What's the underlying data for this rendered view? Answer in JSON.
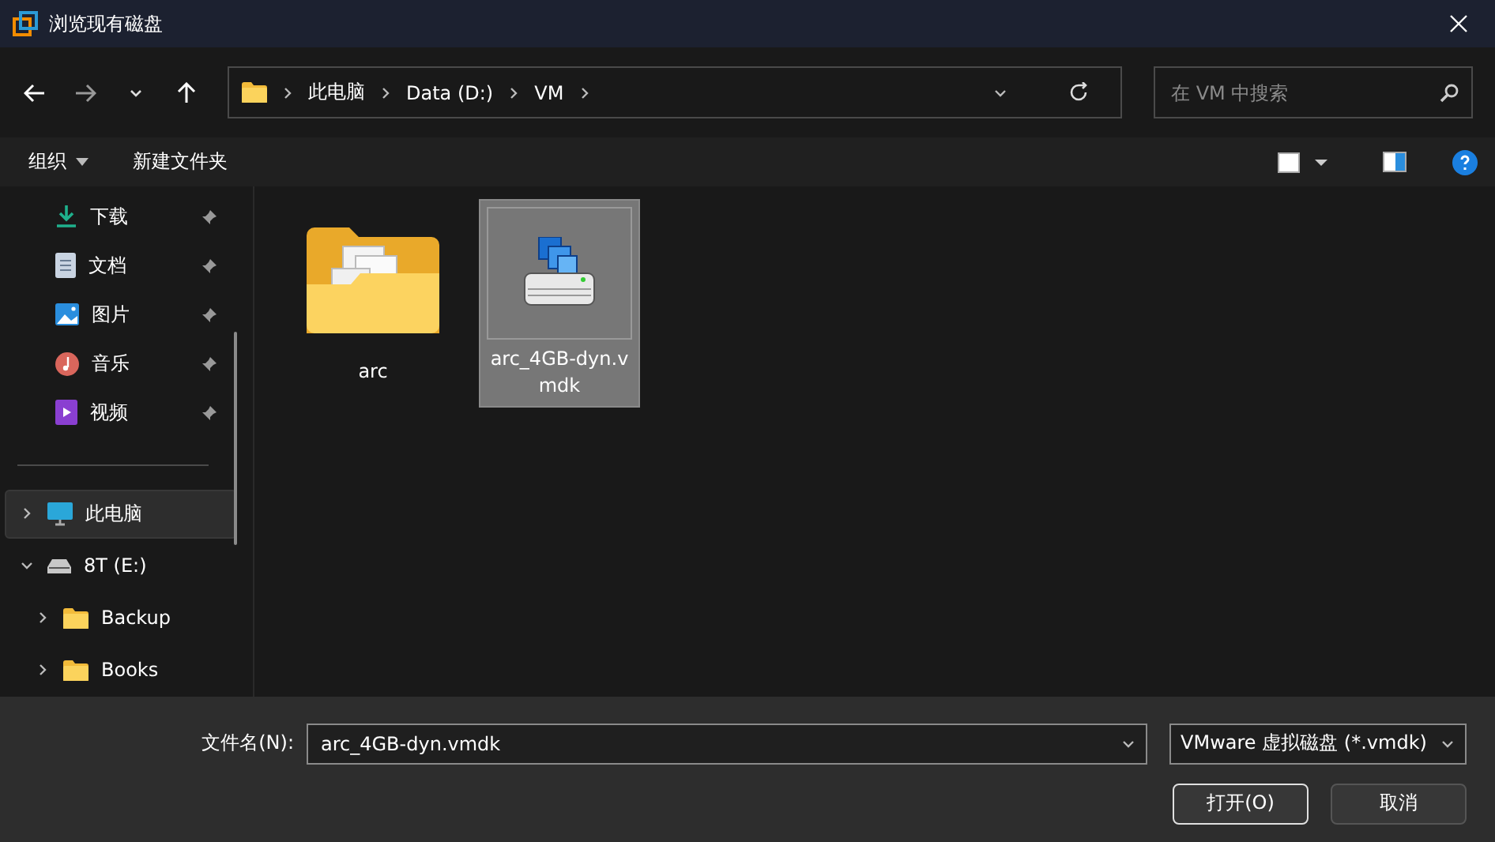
{
  "window": {
    "title": "浏览现有磁盘"
  },
  "address": {
    "path": [
      {
        "label": "此电脑"
      },
      {
        "label": "Data (D:)"
      },
      {
        "label": "VM"
      }
    ]
  },
  "search": {
    "placeholder": "在 VM 中搜索"
  },
  "toolbar": {
    "buttons": [
      {
        "label": "组织",
        "dropdown": true
      },
      {
        "label": "新建文件夹",
        "dropdown": false
      }
    ]
  },
  "sidebar": {
    "quick_access": [
      {
        "label": "下载",
        "kind": "download",
        "pinned": true
      },
      {
        "label": "文档",
        "kind": "document",
        "pinned": true
      },
      {
        "label": "图片",
        "kind": "picture",
        "pinned": true
      },
      {
        "label": "音乐",
        "kind": "music",
        "pinned": true
      },
      {
        "label": "视频",
        "kind": "video",
        "pinned": true
      }
    ],
    "tree": [
      {
        "label": "此电脑",
        "kind": "pc",
        "selected": true,
        "expanded": false
      },
      {
        "label": "8T (E:)",
        "kind": "drive",
        "selected": false,
        "expanded": true,
        "children": [
          {
            "label": "Backup",
            "kind": "folder",
            "selected": false,
            "expanded": false
          },
          {
            "label": "Books",
            "kind": "folder",
            "selected": false,
            "expanded": false
          }
        ]
      }
    ]
  },
  "files": [
    {
      "name": "arc",
      "kind": "folder",
      "selected": false
    },
    {
      "name": "arc_4GB-dyn.vmdk",
      "kind": "disk",
      "selected": true
    }
  ],
  "footer": {
    "filename_label": "文件名(N):",
    "filename": "arc_4GB-dyn.vmdk",
    "filter": "VMware 虚拟磁盘 (*.vmdk)",
    "buttons": [
      {
        "label": "打开(O)",
        "primary": true
      },
      {
        "label": "取消",
        "primary": false
      }
    ]
  }
}
